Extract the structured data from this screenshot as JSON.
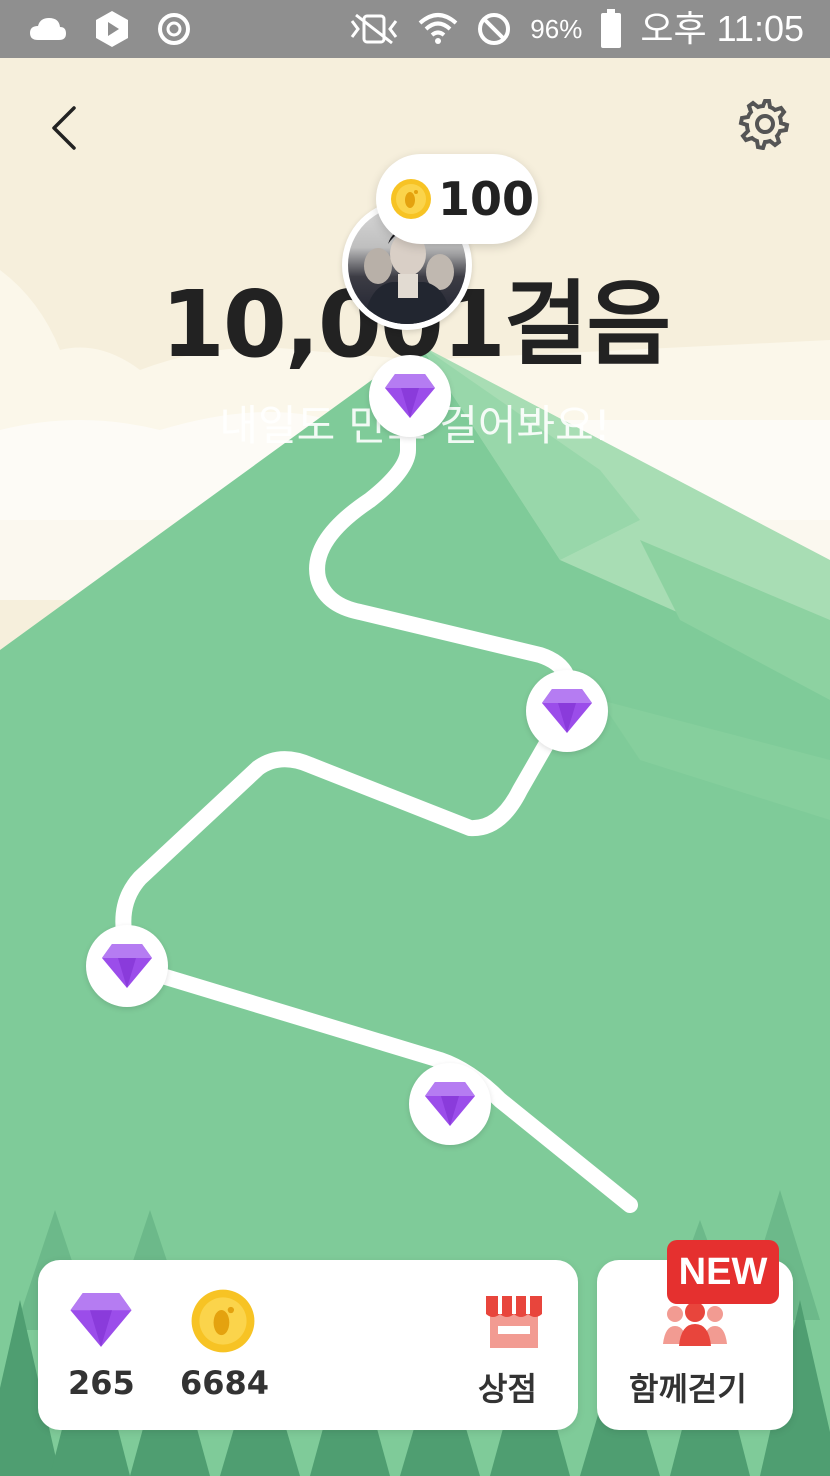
{
  "status_bar": {
    "battery_percent": "96%",
    "time": "오후 11:05",
    "left_icons": [
      "cloud-icon",
      "play-store-icon",
      "sync-icon"
    ],
    "right_icons": [
      "vibrate-icon",
      "wifi-icon",
      "block-icon",
      "battery-icon"
    ]
  },
  "header": {
    "back_icon": "chevron-left-icon",
    "settings_icon": "gear-icon"
  },
  "profile": {
    "coin_reward": "100"
  },
  "steps": {
    "title": "10,001걸음",
    "subtitle": "내일도 만보 걸어봐요!"
  },
  "milestones": [
    {
      "icon": "gem-icon"
    },
    {
      "icon": "gem-icon"
    },
    {
      "icon": "gem-icon"
    },
    {
      "icon": "gem-icon"
    }
  ],
  "wallet": {
    "gems": "265",
    "coins": "6684",
    "shop_label": "상점"
  },
  "walk_together": {
    "badge": "NEW",
    "label": "함께걷기"
  },
  "colors": {
    "mountain": "#7fcb99",
    "sky": "#f6efdc",
    "gem": "#9b4dea",
    "coin": "#f7c324",
    "badge": "#e5302f"
  }
}
